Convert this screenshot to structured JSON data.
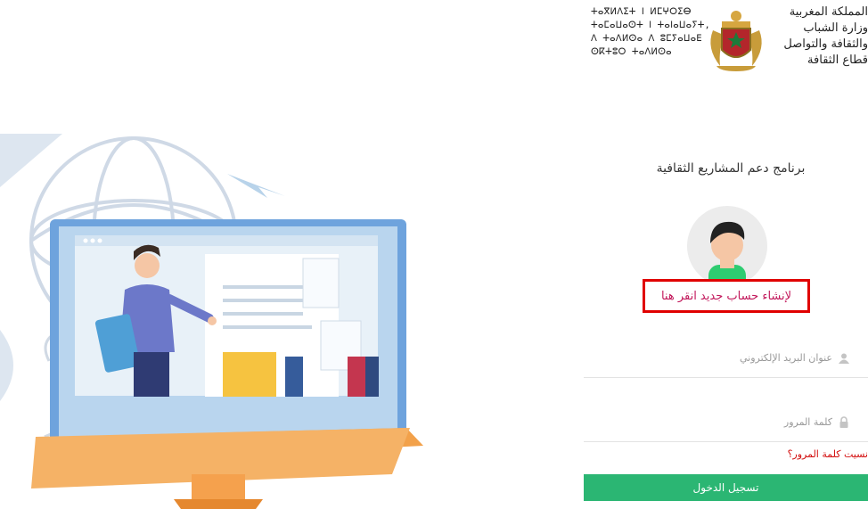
{
  "header": {
    "amazigh_lines": [
      "ⵜⴰⴳⵍⴷⵉⵜ ⵏ ⵍⵎⵖⵔⵉⴱ",
      "ⵜⴰⵎⴰⵡⴰⵙⵜ ⵏ ⵜⴰⵏⴰⵡⴰⵢⵜ,",
      "ⴷ ⵜⴰⴷⵍⵙⴰ ⴷ ⵓⵎⵢⴰⵡⴰⴹ",
      "ⵙⴽⵜⵓⵔ ⵜⴰⴷⵍⵙⴰ"
    ],
    "arabic_lines": [
      "المملكة المغربية",
      "وزارة الشباب",
      "والثقافة والتواصل",
      "قطاع الثقافة"
    ],
    "emblem_icon": "morocco-coat-of-arms-icon"
  },
  "main": {
    "program_title": "برنامج دعم المشاريع الثقافية",
    "avatar_icon": "user-avatar-icon",
    "create_account_link": "لإنشاء حساب جديد انقر هنا"
  },
  "form": {
    "email_placeholder": "عنوان البريد الإلكتروني",
    "password_placeholder": "كلمة المرور",
    "forgot_password": "نسيت كلمة المرور؟",
    "login_button": "تسجيل الدخول"
  },
  "colors": {
    "login_button": "#2bb673",
    "highlight_box": "#e00000",
    "link": "#c2185b",
    "forgot_link": "#d20a0a"
  }
}
